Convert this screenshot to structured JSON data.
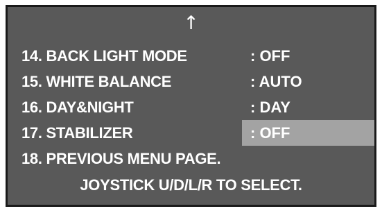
{
  "menu": {
    "scroll_up_glyph": "↑",
    "items": [
      {
        "label": "14. BACK LIGHT MODE",
        "value": ": OFF"
      },
      {
        "label": "15. WHITE BALANCE",
        "value": ": AUTO"
      },
      {
        "label": "16. DAY&NIGHT",
        "value": ": DAY"
      },
      {
        "label": "17. STABILIZER",
        "value": ": OFF",
        "selected": true
      },
      {
        "label": "18. PREVIOUS MENU PAGE.",
        "value": ""
      }
    ],
    "hint": "JOYSTICK U/D/L/R TO SELECT.",
    "colors": {
      "background": "#595959",
      "text": "#ffffff",
      "highlight": "#a3a3a3",
      "border": "#1a1a1a"
    }
  }
}
